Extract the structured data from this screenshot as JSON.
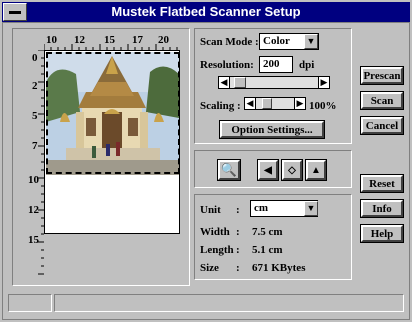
{
  "window": {
    "title": "Mustek Flatbed Scanner Setup"
  },
  "ruler": {
    "top_ticks": [
      "10",
      "12",
      "15",
      "17",
      "20"
    ],
    "left_ticks": [
      "0",
      "2",
      "5",
      "7",
      "10",
      "12",
      "15"
    ]
  },
  "scan_mode": {
    "label": "Scan Mode :",
    "value": "Color"
  },
  "resolution": {
    "label": "Resolution:",
    "value": "200",
    "unit": "dpi"
  },
  "scaling": {
    "label": "Scaling :",
    "value": "100%"
  },
  "option_settings": {
    "label": "Option Settings..."
  },
  "tools": {
    "zoom_icon": "magnifier-icon",
    "icons": [
      "left-arrow-icon",
      "box-icon",
      "image-icon"
    ]
  },
  "info": {
    "unit_label": "Unit",
    "unit_value": "cm",
    "width_label": "Width",
    "width_value": "7.5 cm",
    "length_label": "Length",
    "length_value": "5.1 cm",
    "size_label": "Size",
    "size_value": "671 KBytes",
    "separator": ":"
  },
  "buttons": {
    "prescan": "Prescan",
    "scan": "Scan",
    "cancel": "Cancel",
    "reset": "Reset",
    "info": "Info",
    "help": "Help"
  }
}
